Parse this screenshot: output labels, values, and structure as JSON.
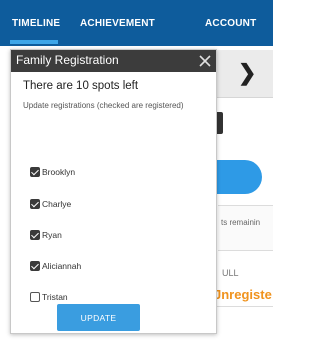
{
  "tabs": [
    {
      "label": "TIMELINE",
      "active": true
    },
    {
      "label": "ACHIEVEMENT",
      "active": false
    },
    {
      "label": "ACCOUNT",
      "active": false
    }
  ],
  "colors": {
    "tab_bar": "#0e5c9c",
    "tab_underline": "#3ea6e8",
    "modal_header": "#3c3c3c",
    "button": "#3a9de0",
    "unregistered": "#f0931e"
  },
  "modal": {
    "title": "Family Registration",
    "close_icon": "close-icon",
    "spots_text": "There are 10 spots left",
    "instructions": "Update registrations (checked are registered)",
    "options": [
      {
        "name": "Brooklyn",
        "checked": true
      },
      {
        "name": "Charlye",
        "checked": true
      },
      {
        "name": "Ryan",
        "checked": true
      },
      {
        "name": "Aliciannah",
        "checked": true
      },
      {
        "name": "Tristan",
        "checked": false
      }
    ],
    "update_label": "UPDATE"
  },
  "background": {
    "chevron_icon": "chevron-right-icon",
    "remaining_text": "ts remainin",
    "full_text": "ULL",
    "unregistered_text": "Jnregiste"
  }
}
